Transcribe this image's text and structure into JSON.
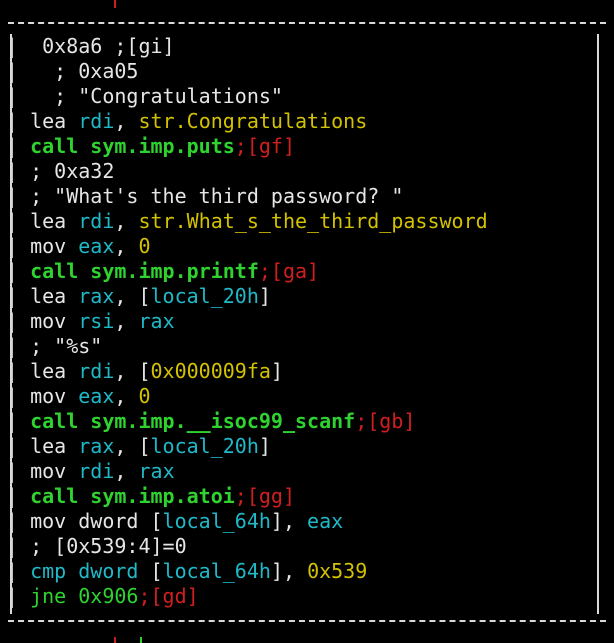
{
  "colors": {
    "background": "#000000",
    "border": "#d9d9d9",
    "text": "#e6e6e6",
    "green": "#2fd32f",
    "yellow": "#d3c200",
    "cyan": "#1fb9c8",
    "red": "#d11f1f"
  },
  "lines": [
    [
      {
        "text": " 0x8a6 ;[gi]",
        "cls": "w"
      }
    ],
    [
      {
        "text": "  ; 0xa05",
        "cls": "w"
      }
    ],
    [
      {
        "text": "  ; \"Congratulations\"",
        "cls": "w"
      }
    ],
    [
      {
        "text": "lea ",
        "cls": "w"
      },
      {
        "text": "rdi",
        "cls": "cyn"
      },
      {
        "text": ", ",
        "cls": "w"
      },
      {
        "text": "str.Congratulations",
        "cls": "yel"
      }
    ],
    [
      {
        "text": "call sym.imp.puts",
        "cls": "grn b"
      },
      {
        "text": ";[gf]",
        "cls": "red"
      }
    ],
    [
      {
        "text": "; 0xa32",
        "cls": "w"
      }
    ],
    [
      {
        "text": "; \"What's the third password? \"",
        "cls": "w"
      }
    ],
    [
      {
        "text": "lea ",
        "cls": "w"
      },
      {
        "text": "rdi",
        "cls": "cyn"
      },
      {
        "text": ", ",
        "cls": "w"
      },
      {
        "text": "str.What_s_the_third_password",
        "cls": "yel"
      }
    ],
    [
      {
        "text": "mov ",
        "cls": "w"
      },
      {
        "text": "eax",
        "cls": "cyn"
      },
      {
        "text": ", ",
        "cls": "w"
      },
      {
        "text": "0",
        "cls": "yel"
      }
    ],
    [
      {
        "text": "call sym.imp.printf",
        "cls": "grn b"
      },
      {
        "text": ";[ga]",
        "cls": "red"
      }
    ],
    [
      {
        "text": "lea ",
        "cls": "w"
      },
      {
        "text": "rax",
        "cls": "cyn"
      },
      {
        "text": ", [",
        "cls": "w"
      },
      {
        "text": "local_20h",
        "cls": "cyn"
      },
      {
        "text": "]",
        "cls": "w"
      }
    ],
    [
      {
        "text": "mov ",
        "cls": "w"
      },
      {
        "text": "rsi",
        "cls": "cyn"
      },
      {
        "text": ", ",
        "cls": "w"
      },
      {
        "text": "rax",
        "cls": "cyn"
      }
    ],
    [
      {
        "text": "; \"%s\"",
        "cls": "w"
      }
    ],
    [
      {
        "text": "lea ",
        "cls": "w"
      },
      {
        "text": "rdi",
        "cls": "cyn"
      },
      {
        "text": ", [",
        "cls": "w"
      },
      {
        "text": "0x000009fa",
        "cls": "yel"
      },
      {
        "text": "]",
        "cls": "w"
      }
    ],
    [
      {
        "text": "mov ",
        "cls": "w"
      },
      {
        "text": "eax",
        "cls": "cyn"
      },
      {
        "text": ", ",
        "cls": "w"
      },
      {
        "text": "0",
        "cls": "yel"
      }
    ],
    [
      {
        "text": "call sym.imp.__isoc99_scanf",
        "cls": "grn b"
      },
      {
        "text": ";[gb]",
        "cls": "red"
      }
    ],
    [
      {
        "text": "lea ",
        "cls": "w"
      },
      {
        "text": "rax",
        "cls": "cyn"
      },
      {
        "text": ", [",
        "cls": "w"
      },
      {
        "text": "local_20h",
        "cls": "cyn"
      },
      {
        "text": "]",
        "cls": "w"
      }
    ],
    [
      {
        "text": "mov ",
        "cls": "w"
      },
      {
        "text": "rdi",
        "cls": "cyn"
      },
      {
        "text": ", ",
        "cls": "w"
      },
      {
        "text": "rax",
        "cls": "cyn"
      }
    ],
    [
      {
        "text": "call sym.imp.atoi",
        "cls": "grn b"
      },
      {
        "text": ";[gg]",
        "cls": "red"
      }
    ],
    [
      {
        "text": "mov dword [",
        "cls": "w"
      },
      {
        "text": "local_64h",
        "cls": "cyn"
      },
      {
        "text": "], ",
        "cls": "w"
      },
      {
        "text": "eax",
        "cls": "cyn"
      }
    ],
    [
      {
        "text": "; [0x539:4]=0",
        "cls": "w"
      }
    ],
    [
      {
        "text": "cmp dword ",
        "cls": "cyn"
      },
      {
        "text": "[",
        "cls": "w"
      },
      {
        "text": "local_64h",
        "cls": "cyn"
      },
      {
        "text": "], ",
        "cls": "w"
      },
      {
        "text": "0x539",
        "cls": "yel"
      }
    ],
    [
      {
        "text": "jne 0x906",
        "cls": "grn"
      },
      {
        "text": ";[gd]",
        "cls": "red"
      }
    ]
  ]
}
